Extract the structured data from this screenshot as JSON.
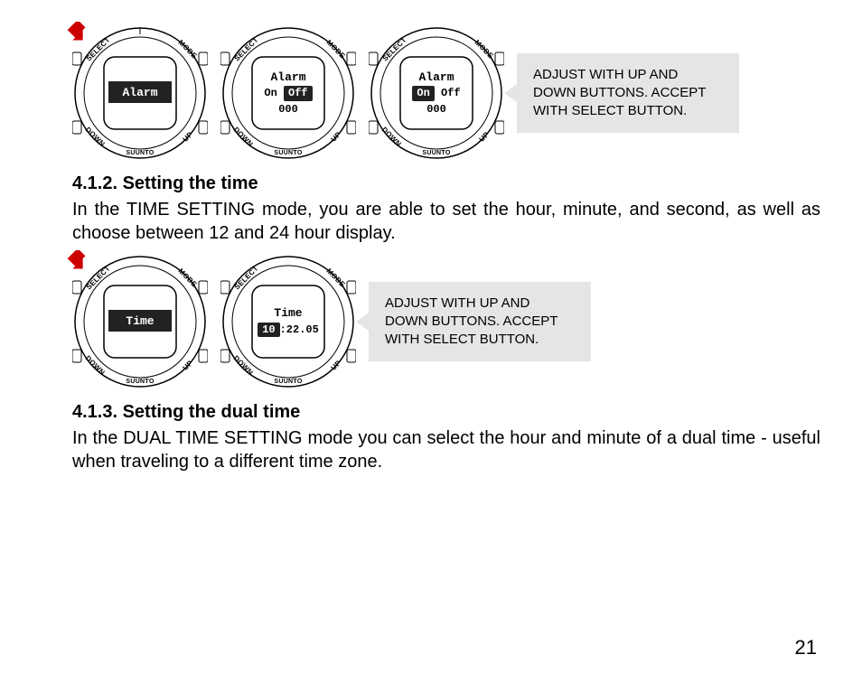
{
  "pageNumber": "21",
  "watchLabels": {
    "select": "SELECT",
    "mode": "MODE",
    "down": "DOWN",
    "up": "UP",
    "brand": "SUUNTO"
  },
  "block1": {
    "callout": "ADJUST WITH UP AND DOWN BUTTONS. ACCEPT WITH SELECT BUTTON.",
    "watches": [
      {
        "line1_inv": "Alarm",
        "line2_a": "",
        "line2_inv": "",
        "line2_b": "",
        "line3": ""
      },
      {
        "line1": "Alarm",
        "line2_a": "On ",
        "line2_inv": "Off",
        "line2_b": "",
        "line3": "000"
      },
      {
        "line1": "Alarm",
        "line2_a": "",
        "line2_inv": "On",
        "line2_b": " Off",
        "line3": "000"
      }
    ]
  },
  "section412": {
    "heading": "4.1.2. Setting the time",
    "body": "In the TIME SETTING mode, you are able to set the hour, minute, and second, as well as choose between 12 and 24 hour display."
  },
  "block2": {
    "callout": "ADJUST WITH UP AND DOWN BUTTONS. ACCEPT WITH SELECT BUTTON.",
    "watches": [
      {
        "line1_inv": "Time",
        "line2_a": "",
        "line2_inv": "",
        "line2_b": "",
        "line3": ""
      },
      {
        "line1": "Time",
        "line2_a": "",
        "line2_inv": "10",
        "line2_b": ":22.05",
        "line3": ""
      }
    ]
  },
  "section413": {
    "heading": "4.1.3. Setting the dual time",
    "body": "In the DUAL TIME SETTING mode you can select the hour and minute of a dual time - useful when traveling to a different time zone."
  }
}
